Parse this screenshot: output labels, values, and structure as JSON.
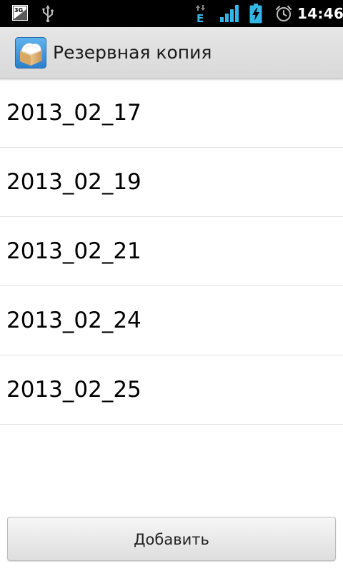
{
  "status_bar": {
    "network_badge": "3G",
    "data_indicator": "E",
    "time": "14:46",
    "icons": [
      "3g-icon",
      "usb-icon",
      "data-arrows-icon",
      "signal-icon",
      "battery-charging-icon",
      "alarm-icon"
    ]
  },
  "title_bar": {
    "title": "Резервная копия",
    "icon": "backup-box-icon"
  },
  "list": {
    "items": [
      {
        "label": "2013_02_17"
      },
      {
        "label": "2013_02_19"
      },
      {
        "label": "2013_02_21"
      },
      {
        "label": "2013_02_24"
      },
      {
        "label": "2013_02_25"
      }
    ]
  },
  "actions": {
    "add_label": "Добавить"
  },
  "colors": {
    "status_bar_bg": "#000000",
    "status_icon": "#33b5e5",
    "title_bar_bg": "#dcdcdc",
    "list_bg": "#ffffff",
    "divider": "#e3e3e3"
  }
}
